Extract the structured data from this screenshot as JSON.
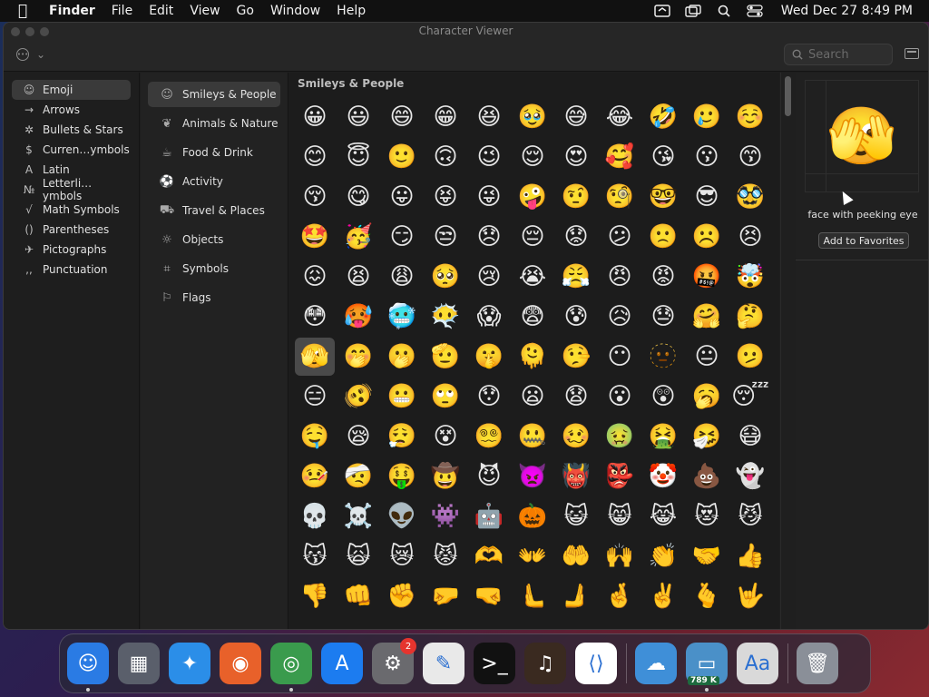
{
  "menubar": {
    "apple": "",
    "app_name": "Finder",
    "menus": [
      "File",
      "Edit",
      "View",
      "Go",
      "Window",
      "Help"
    ],
    "clock": "Wed Dec 27  8:49 PM"
  },
  "window": {
    "title": "Character Viewer",
    "options_chevron": "⌄",
    "search_placeholder": "Search"
  },
  "sidebar": {
    "items": [
      {
        "icon": "☺",
        "label": "Emoji"
      },
      {
        "icon": "→",
        "label": "Arrows"
      },
      {
        "icon": "✲",
        "label": "Bullets & Stars"
      },
      {
        "icon": "$",
        "label": "Curren…ymbols"
      },
      {
        "icon": "A",
        "label": "Latin"
      },
      {
        "icon": "№",
        "label": "Letterli…ymbols"
      },
      {
        "icon": "√",
        "label": "Math Symbols"
      },
      {
        "icon": "()",
        "label": "Parentheses"
      },
      {
        "icon": "✈",
        "label": "Pictographs"
      },
      {
        "icon": ",,",
        "label": "Punctuation"
      }
    ]
  },
  "subcategories": {
    "items": [
      {
        "icon": "☺",
        "label": "Smileys & People"
      },
      {
        "icon": "❦",
        "label": "Animals & Nature"
      },
      {
        "icon": "☕",
        "label": "Food & Drink"
      },
      {
        "icon": "⚽",
        "label": "Activity"
      },
      {
        "icon": "⛟",
        "label": "Travel & Places"
      },
      {
        "icon": "☼",
        "label": "Objects"
      },
      {
        "icon": "⌗",
        "label": "Symbols"
      },
      {
        "icon": "⚐",
        "label": "Flags"
      }
    ]
  },
  "grid": {
    "title": "Smileys & People",
    "emojis": [
      "😀",
      "😃",
      "😄",
      "😁",
      "😆",
      "🥹",
      "😅",
      "😂",
      "🤣",
      "🥲",
      "☺️",
      "😊",
      "😇",
      "🙂",
      "🙃",
      "😉",
      "😌",
      "😍",
      "🥰",
      "😘",
      "😗",
      "😙",
      "😚",
      "😋",
      "😛",
      "😝",
      "😜",
      "🤪",
      "🤨",
      "🧐",
      "🤓",
      "😎",
      "🥸",
      "🤩",
      "🥳",
      "😏",
      "😒",
      "😞",
      "😔",
      "😟",
      "😕",
      "🙁",
      "☹️",
      "😣",
      "😖",
      "😫",
      "😩",
      "🥺",
      "😢",
      "😭",
      "😤",
      "😠",
      "😡",
      "🤬",
      "🤯",
      "😳",
      "🥵",
      "🥶",
      "😶‍🌫️",
      "😱",
      "😨",
      "😰",
      "😥",
      "😓",
      "🤗",
      "🤔",
      "🫣",
      "🤭",
      "🫢",
      "🫡",
      "🤫",
      "🫠",
      "🤥",
      "😶",
      "🫥",
      "😐",
      "🫤",
      "😑",
      "🫨",
      "😬",
      "🙄",
      "😯",
      "😦",
      "😧",
      "😮",
      "😲",
      "🥱",
      "😴",
      "🤤",
      "😪",
      "😮‍💨",
      "😵",
      "😵‍💫",
      "🤐",
      "🥴",
      "🤢",
      "🤮",
      "🤧",
      "😷",
      "🤒",
      "🤕",
      "🤑",
      "🤠",
      "😈",
      "👿",
      "👹",
      "👺",
      "🤡",
      "💩",
      "👻",
      "💀",
      "☠️",
      "👽",
      "👾",
      "🤖",
      "🎃",
      "😺",
      "😸",
      "😹",
      "😻",
      "😼",
      "😽",
      "🙀",
      "😿",
      "😾",
      "🫶",
      "👐",
      "🤲",
      "🙌",
      "👏",
      "🤝",
      "👍",
      "👎",
      "👊",
      "✊",
      "🤛",
      "🤜",
      "🫷",
      "🫸",
      "🤞",
      "✌️",
      "🫰",
      "🤟"
    ]
  },
  "preview": {
    "emoji": "🫣",
    "name": "face with peeking eye",
    "favorites_button": "Add to Favorites"
  },
  "dock": {
    "apps": [
      {
        "name": "finder",
        "glyph": "☺",
        "color": "#2a7be4"
      },
      {
        "name": "launchpad",
        "glyph": "▦",
        "color": "#5a5f6b"
      },
      {
        "name": "safari",
        "glyph": "✦",
        "color": "#2b8ee8"
      },
      {
        "name": "firefox",
        "glyph": "◉",
        "color": "#e8612a"
      },
      {
        "name": "chrome",
        "glyph": "◎",
        "color": "#3a9b4d"
      },
      {
        "name": "app-store",
        "glyph": "A",
        "color": "#1c7cf0"
      },
      {
        "name": "system-settings",
        "glyph": "⚙",
        "color": "#6a6a6e",
        "badge": "2"
      },
      {
        "name": "textedit",
        "glyph": "✎",
        "color": "#e9e9e9"
      },
      {
        "name": "terminal",
        "glyph": ">_",
        "color": "#111111"
      },
      {
        "name": "garageband",
        "glyph": "♫",
        "color": "#3a2a20"
      },
      {
        "name": "vscode",
        "glyph": "⟨⟩",
        "color": "#ffffff"
      },
      {
        "name": "weather",
        "glyph": "☁",
        "color": "#3f8fd8"
      },
      {
        "name": "network-monitor",
        "glyph": "▭",
        "color": "#4a90c8",
        "net": "789 K"
      },
      {
        "name": "font-book",
        "glyph": "Aa",
        "color": "#d9d9d9"
      },
      {
        "name": "trash",
        "glyph": "🗑",
        "color": "#8a8f98"
      }
    ]
  },
  "colors": {
    "selection": "#3a3a3a",
    "badge": "#e5342e"
  }
}
